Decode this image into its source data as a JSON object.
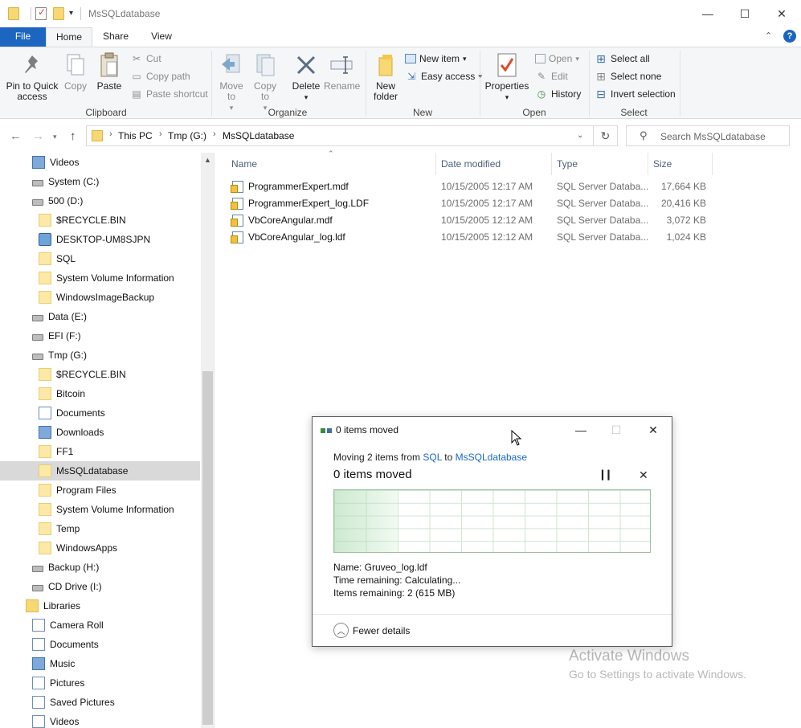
{
  "window": {
    "title": "MsSQLdatabase",
    "controls": {
      "minimize": "—",
      "maximize": "☐",
      "close": "✕"
    }
  },
  "ribbon": {
    "tabs": [
      "File",
      "Home",
      "Share",
      "View"
    ],
    "clipboard": {
      "pin_label": "Pin to Quick access",
      "copy": "Copy",
      "paste": "Paste",
      "cut": "Cut",
      "copy_path": "Copy path",
      "paste_shortcut": "Paste shortcut",
      "group": "Clipboard"
    },
    "organize": {
      "move_to": "Move to",
      "copy_to": "Copy to",
      "delete": "Delete",
      "rename": "Rename",
      "group": "Organize"
    },
    "new": {
      "new_folder": "New folder",
      "new_item": "New item",
      "easy_access": "Easy access",
      "group": "New"
    },
    "open": {
      "properties": "Properties",
      "open": "Open",
      "edit": "Edit",
      "history": "History",
      "group": "Open"
    },
    "select": {
      "select_all": "Select all",
      "select_none": "Select none",
      "invert": "Invert selection",
      "group": "Select"
    }
  },
  "address": {
    "crumbs": [
      "This PC",
      "Tmp (G:)",
      "MsSQLdatabase"
    ],
    "search_placeholder": "Search MsSQLdatabase"
  },
  "nav_items": [
    {
      "label": "Videos",
      "icon": "videos-icon"
    },
    {
      "label": "System (C:)",
      "icon": "drive-icon"
    },
    {
      "label": "500 (D:)",
      "icon": "drive-icon"
    },
    {
      "label": "$RECYCLE.BIN",
      "icon": "folder-icon"
    },
    {
      "label": "DESKTOP-UM8SJPN",
      "icon": "network-icon"
    },
    {
      "label": "SQL",
      "icon": "folder-icon"
    },
    {
      "label": "System Volume Information",
      "icon": "folder-icon"
    },
    {
      "label": "WindowsImageBackup",
      "icon": "folder-icon"
    },
    {
      "label": "Data (E:)",
      "icon": "drive-icon"
    },
    {
      "label": "EFI (F:)",
      "icon": "drive-icon"
    },
    {
      "label": "Tmp (G:)",
      "icon": "drive-icon"
    },
    {
      "label": "$RECYCLE.BIN",
      "icon": "folder-icon"
    },
    {
      "label": "Bitcoin",
      "icon": "folder-icon"
    },
    {
      "label": "Documents",
      "icon": "documents-icon"
    },
    {
      "label": "Downloads",
      "icon": "downloads-icon"
    },
    {
      "label": "FF1",
      "icon": "folder-icon"
    },
    {
      "label": "MsSQLdatabase",
      "icon": "folder-icon"
    },
    {
      "label": "Program Files",
      "icon": "folder-icon"
    },
    {
      "label": "System Volume Information",
      "icon": "folder-icon"
    },
    {
      "label": "Temp",
      "icon": "folder-icon"
    },
    {
      "label": "WindowsApps",
      "icon": "folder-icon"
    },
    {
      "label": "Backup (H:)",
      "icon": "drive-icon"
    },
    {
      "label": "CD Drive (I:)",
      "icon": "drive-icon"
    },
    {
      "label": "Libraries",
      "icon": "libraries-icon"
    },
    {
      "label": "Camera Roll",
      "icon": "library-icon"
    },
    {
      "label": "Documents",
      "icon": "library-icon"
    },
    {
      "label": "Music",
      "icon": "music-icon"
    },
    {
      "label": "Pictures",
      "icon": "library-icon"
    },
    {
      "label": "Saved Pictures",
      "icon": "library-icon"
    },
    {
      "label": "Videos",
      "icon": "library-icon"
    }
  ],
  "nav_selected": "MsSQLdatabase",
  "columns": [
    "Name",
    "Date modified",
    "Type",
    "Size"
  ],
  "files": [
    {
      "name": "ProgrammerExpert.mdf",
      "date": "10/15/2005 12:17 AM",
      "type": "SQL Server Databa...",
      "size": "17,664 KB"
    },
    {
      "name": "ProgrammerExpert_log.LDF",
      "date": "10/15/2005 12:17 AM",
      "type": "SQL Server Databa...",
      "size": "20,416 KB"
    },
    {
      "name": "VbCoreAngular.mdf",
      "date": "10/15/2005 12:12 AM",
      "type": "SQL Server Databa...",
      "size": "3,072 KB"
    },
    {
      "name": "VbCoreAngular_log.ldf",
      "date": "10/15/2005 12:12 AM",
      "type": "SQL Server Databa...",
      "size": "1,024 KB"
    }
  ],
  "dialog": {
    "title": "0 items moved",
    "moving_prefix": "Moving 2 items from ",
    "source": "SQL",
    "to_word": " to ",
    "dest": "MsSQLdatabase",
    "status": "0 items moved",
    "progress_fraction": 0.0,
    "name_line": "Name:  Gruveo_log.ldf",
    "time_line": "Time remaining:  Calculating...",
    "items_line": "Items remaining:  2 (615 MB)",
    "fewer_details": "Fewer details"
  },
  "watermark": {
    "line1": "Activate Windows",
    "line2": "Go to Settings to activate Windows."
  },
  "colors": {
    "accent": "#1c65c0",
    "link": "#1b68c7",
    "selected_bg": "#d9d9d9",
    "folder": "#f8d775"
  }
}
